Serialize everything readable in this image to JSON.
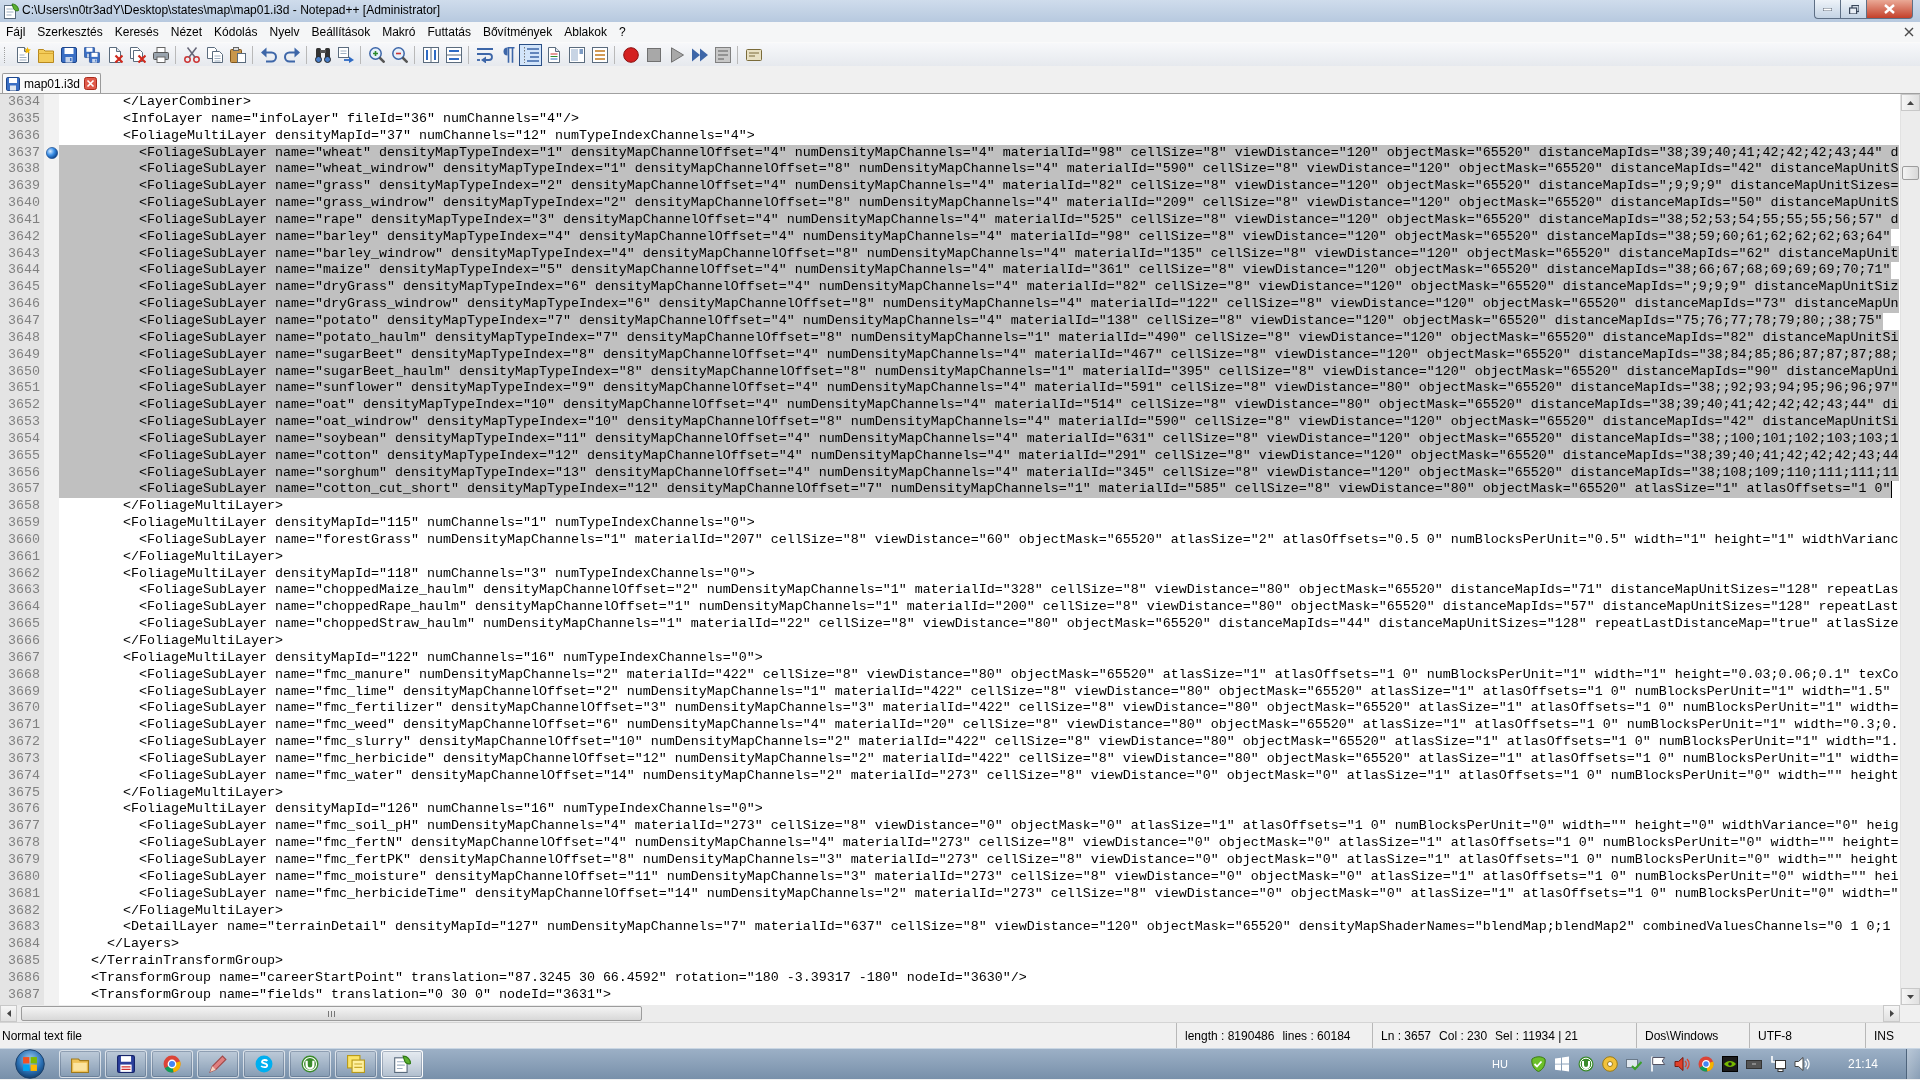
{
  "window": {
    "title": "C:\\Users\\n0tr3adY\\Desktop\\states\\map\\map01.i3d - Notepad++ [Administrator]"
  },
  "menu": [
    "Fájl",
    "Szerkesztés",
    "Keresés",
    "Nézet",
    "Kódolás",
    "Nyelv",
    "Beállítások",
    "Makró",
    "Futtatás",
    "Bővítmények",
    "Ablakok",
    "?"
  ],
  "toolbar": {
    "groups": [
      [
        {
          "pressed": false
        },
        {
          "pressed": false
        },
        {
          "pressed": false
        },
        {
          "pressed": false
        },
        {
          "pressed": false
        },
        {
          "pressed": false
        },
        {
          "pressed": false
        }
      ],
      [
        {
          "pressed": false
        },
        {
          "pressed": false
        },
        {
          "pressed": false
        }
      ],
      [
        {
          "pressed": false
        },
        {
          "pressed": false
        }
      ],
      [
        {
          "pressed": false
        },
        {
          "pressed": false
        }
      ],
      [
        {
          "pressed": false
        },
        {
          "pressed": false
        }
      ],
      [
        {
          "pressed": false
        },
        {
          "pressed": false
        }
      ],
      [
        {
          "pressed": false
        },
        {
          "pressed": false
        },
        {
          "pressed": true
        },
        {
          "pressed": false
        },
        {
          "pressed": false
        },
        {
          "pressed": false
        }
      ],
      [
        {
          "pressed": false
        },
        {
          "pressed": false
        },
        {
          "pressed": false
        },
        {
          "pressed": false
        },
        {
          "pressed": false
        }
      ],
      [
        {
          "pressed": false
        }
      ]
    ]
  },
  "tabs": [
    {
      "label": "map01.i3d",
      "selected": true,
      "modified": false
    }
  ],
  "editor": {
    "lines": [
      {
        "number": "3634",
        "text": "        </LayerCombiner>",
        "selected": false,
        "bookmarked": false,
        "caret": false
      },
      {
        "number": "3635",
        "text": "        <InfoLayer name=\"infoLayer\" fileId=\"36\" numChannels=\"4\"/>",
        "selected": false,
        "bookmarked": false,
        "caret": false
      },
      {
        "number": "3636",
        "text": "        <FoliageMultiLayer densityMapId=\"37\" numChannels=\"12\" numTypeIndexChannels=\"4\">",
        "selected": false,
        "bookmarked": false,
        "caret": false
      },
      {
        "number": "3637",
        "text": "          <FoliageSubLayer name=\"wheat\" densityMapTypeIndex=\"1\" densityMapChannelOffset=\"4\" numDensityMapChannels=\"4\" materialId=\"98\" cellSize=\"8\" viewDistance=\"120\" objectMask=\"65520\" distanceMapIds=\"38;39;40;41;42;42;42;43;44\" d",
        "selected": true,
        "bookmarked": true,
        "caret": false
      },
      {
        "number": "3638",
        "text": "          <FoliageSubLayer name=\"wheat_windrow\" densityMapTypeIndex=\"1\" densityMapChannelOffset=\"8\" numDensityMapChannels=\"4\" materialId=\"590\" cellSize=\"8\" viewDistance=\"120\" objectMask=\"65520\" distanceMapIds=\"42\" distanceMapUnitS",
        "selected": true,
        "bookmarked": false,
        "caret": false
      },
      {
        "number": "3639",
        "text": "          <FoliageSubLayer name=\"grass\" densityMapTypeIndex=\"2\" densityMapChannelOffset=\"4\" numDensityMapChannels=\"4\" materialId=\"82\" cellSize=\"8\" viewDistance=\"120\" objectMask=\"65520\" distanceMapIds=\";9;9;9\" distanceMapUnitSizes=",
        "selected": true,
        "bookmarked": false,
        "caret": false
      },
      {
        "number": "3640",
        "text": "          <FoliageSubLayer name=\"grass_windrow\" densityMapTypeIndex=\"2\" densityMapChannelOffset=\"8\" numDensityMapChannels=\"4\" materialId=\"209\" cellSize=\"8\" viewDistance=\"120\" objectMask=\"65520\" distanceMapIds=\"50\" distanceMapUnitS",
        "selected": true,
        "bookmarked": false,
        "caret": false
      },
      {
        "number": "3641",
        "text": "          <FoliageSubLayer name=\"rape\" densityMapTypeIndex=\"3\" densityMapChannelOffset=\"4\" numDensityMapChannels=\"4\" materialId=\"525\" cellSize=\"8\" viewDistance=\"120\" objectMask=\"65520\" distanceMapIds=\"38;52;53;54;55;55;55;56;57\" d",
        "selected": true,
        "bookmarked": false,
        "caret": false
      },
      {
        "number": "3642",
        "text": "          <FoliageSubLayer name=\"barley\" densityMapTypeIndex=\"4\" densityMapChannelOffset=\"4\" numDensityMapChannels=\"4\" materialId=\"98\" cellSize=\"8\" viewDistance=\"120\" objectMask=\"65520\" distanceMapIds=\"38;59;60;61;62;62;62;63;64\"",
        "selected": true,
        "bookmarked": false,
        "caret": false
      },
      {
        "number": "3643",
        "text": "          <FoliageSubLayer name=\"barley_windrow\" densityMapTypeIndex=\"4\" densityMapChannelOffset=\"8\" numDensityMapChannels=\"4\" materialId=\"135\" cellSize=\"8\" viewDistance=\"120\" objectMask=\"65520\" distanceMapIds=\"62\" distanceMapUnit",
        "selected": true,
        "bookmarked": false,
        "caret": false
      },
      {
        "number": "3644",
        "text": "          <FoliageSubLayer name=\"maize\" densityMapTypeIndex=\"5\" densityMapChannelOffset=\"4\" numDensityMapChannels=\"4\" materialId=\"361\" cellSize=\"8\" viewDistance=\"120\" objectMask=\"65520\" distanceMapIds=\"38;66;67;68;69;69;69;70;71\"",
        "selected": true,
        "bookmarked": false,
        "caret": false
      },
      {
        "number": "3645",
        "text": "          <FoliageSubLayer name=\"dryGrass\" densityMapTypeIndex=\"6\" densityMapChannelOffset=\"4\" numDensityMapChannels=\"4\" materialId=\"82\" cellSize=\"8\" viewDistance=\"120\" objectMask=\"65520\" distanceMapIds=\";9;9;9\" distanceMapUnitSiz",
        "selected": true,
        "bookmarked": false,
        "caret": false
      },
      {
        "number": "3646",
        "text": "          <FoliageSubLayer name=\"dryGrass_windrow\" densityMapTypeIndex=\"6\" densityMapChannelOffset=\"8\" numDensityMapChannels=\"4\" materialId=\"122\" cellSize=\"8\" viewDistance=\"120\" objectMask=\"65520\" distanceMapIds=\"73\" distanceMapUn",
        "selected": true,
        "bookmarked": false,
        "caret": false
      },
      {
        "number": "3647",
        "text": "          <FoliageSubLayer name=\"potato\" densityMapTypeIndex=\"7\" densityMapChannelOffset=\"4\" numDensityMapChannels=\"4\" materialId=\"138\" cellSize=\"8\" viewDistance=\"120\" objectMask=\"65520\" distanceMapIds=\"75;76;77;78;79;80;;38;75\"",
        "selected": true,
        "bookmarked": false,
        "caret": false
      },
      {
        "number": "3648",
        "text": "          <FoliageSubLayer name=\"potato_haulm\" densityMapTypeIndex=\"7\" densityMapChannelOffset=\"8\" numDensityMapChannels=\"1\" materialId=\"490\" cellSize=\"8\" viewDistance=\"120\" objectMask=\"65520\" distanceMapIds=\"82\" distanceMapUnitSi",
        "selected": true,
        "bookmarked": false,
        "caret": false
      },
      {
        "number": "3649",
        "text": "          <FoliageSubLayer name=\"sugarBeet\" densityMapTypeIndex=\"8\" densityMapChannelOffset=\"4\" numDensityMapChannels=\"4\" materialId=\"467\" cellSize=\"8\" viewDistance=\"120\" objectMask=\"65520\" distanceMapIds=\"38;84;85;86;87;87;87;88;",
        "selected": true,
        "bookmarked": false,
        "caret": false
      },
      {
        "number": "3650",
        "text": "          <FoliageSubLayer name=\"sugarBeet_haulm\" densityMapTypeIndex=\"8\" densityMapChannelOffset=\"8\" numDensityMapChannels=\"1\" materialId=\"395\" cellSize=\"8\" viewDistance=\"120\" objectMask=\"65520\" distanceMapIds=\"90\" distanceMapUni",
        "selected": true,
        "bookmarked": false,
        "caret": false
      },
      {
        "number": "3651",
        "text": "          <FoliageSubLayer name=\"sunflower\" densityMapTypeIndex=\"9\" densityMapChannelOffset=\"4\" numDensityMapChannels=\"4\" materialId=\"591\" cellSize=\"8\" viewDistance=\"80\" objectMask=\"65520\" distanceMapIds=\"38;;92;93;94;95;96;96;97\"",
        "selected": true,
        "bookmarked": false,
        "caret": false
      },
      {
        "number": "3652",
        "text": "          <FoliageSubLayer name=\"oat\" densityMapTypeIndex=\"10\" densityMapChannelOffset=\"4\" numDensityMapChannels=\"4\" materialId=\"514\" cellSize=\"8\" viewDistance=\"80\" objectMask=\"65520\" distanceMapIds=\"38;39;40;41;42;42;42;43;44\" di",
        "selected": true,
        "bookmarked": false,
        "caret": false
      },
      {
        "number": "3653",
        "text": "          <FoliageSubLayer name=\"oat_windrow\" densityMapTypeIndex=\"10\" densityMapChannelOffset=\"8\" numDensityMapChannels=\"4\" materialId=\"590\" cellSize=\"8\" viewDistance=\"120\" objectMask=\"65520\" distanceMapIds=\"42\" distanceMapUnitSi",
        "selected": true,
        "bookmarked": false,
        "caret": false
      },
      {
        "number": "3654",
        "text": "          <FoliageSubLayer name=\"soybean\" densityMapTypeIndex=\"11\" densityMapChannelOffset=\"4\" numDensityMapChannels=\"4\" materialId=\"631\" cellSize=\"8\" viewDistance=\"120\" objectMask=\"65520\" distanceMapIds=\"38;;100;101;102;103;103;1",
        "selected": true,
        "bookmarked": false,
        "caret": false
      },
      {
        "number": "3655",
        "text": "          <FoliageSubLayer name=\"cotton\" densityMapTypeIndex=\"12\" densityMapChannelOffset=\"4\" numDensityMapChannels=\"4\" materialId=\"291\" cellSize=\"8\" viewDistance=\"120\" objectMask=\"65520\" distanceMapIds=\"38;39;40;41;42;42;42;43;44",
        "selected": true,
        "bookmarked": false,
        "caret": false
      },
      {
        "number": "3656",
        "text": "          <FoliageSubLayer name=\"sorghum\" densityMapTypeIndex=\"13\" densityMapChannelOffset=\"4\" numDensityMapChannels=\"4\" materialId=\"345\" cellSize=\"8\" viewDistance=\"120\" objectMask=\"65520\" distanceMapIds=\"38;108;109;110;111;111;11",
        "selected": true,
        "bookmarked": false,
        "caret": false
      },
      {
        "number": "3657",
        "text": "          <FoliageSubLayer name=\"cotton_cut_short\" densityMapTypeIndex=\"12\" densityMapChannelOffset=\"7\" numDensityMapChannels=\"1\" materialId=\"585\" cellSize=\"8\" viewDistance=\"80\" objectMask=\"65520\" atlasSize=\"1\" atlasOffsets=\"1 0\"",
        "selected": true,
        "bookmarked": false,
        "caret": true
      },
      {
        "number": "3658",
        "text": "        </FoliageMultiLayer>",
        "selected": false,
        "bookmarked": false,
        "caret": false
      },
      {
        "number": "3659",
        "text": "        <FoliageMultiLayer densityMapId=\"115\" numChannels=\"1\" numTypeIndexChannels=\"0\">",
        "selected": false,
        "bookmarked": false,
        "caret": false
      },
      {
        "number": "3660",
        "text": "          <FoliageSubLayer name=\"forestGrass\" numDensityMapChannels=\"1\" materialId=\"207\" cellSize=\"8\" viewDistance=\"60\" objectMask=\"65520\" atlasSize=\"2\" atlasOffsets=\"0.5 0\" numBlocksPerUnit=\"0.5\" width=\"1\" height=\"1\" widthVarianc",
        "selected": false,
        "bookmarked": false,
        "caret": false
      },
      {
        "number": "3661",
        "text": "        </FoliageMultiLayer>",
        "selected": false,
        "bookmarked": false,
        "caret": false
      },
      {
        "number": "3662",
        "text": "        <FoliageMultiLayer densityMapId=\"118\" numChannels=\"3\" numTypeIndexChannels=\"0\">",
        "selected": false,
        "bookmarked": false,
        "caret": false
      },
      {
        "number": "3663",
        "text": "          <FoliageSubLayer name=\"choppedMaize_haulm\" densityMapChannelOffset=\"2\" numDensityMapChannels=\"1\" materialId=\"328\" cellSize=\"8\" viewDistance=\"80\" objectMask=\"65520\" distanceMapIds=\"71\" distanceMapUnitSizes=\"128\" repeatLas",
        "selected": false,
        "bookmarked": false,
        "caret": false
      },
      {
        "number": "3664",
        "text": "          <FoliageSubLayer name=\"choppedRape_haulm\" densityMapChannelOffset=\"1\" numDensityMapChannels=\"1\" materialId=\"200\" cellSize=\"8\" viewDistance=\"80\" objectMask=\"65520\" distanceMapIds=\"57\" distanceMapUnitSizes=\"128\" repeatLast",
        "selected": false,
        "bookmarked": false,
        "caret": false
      },
      {
        "number": "3665",
        "text": "          <FoliageSubLayer name=\"choppedStraw_haulm\" numDensityMapChannels=\"1\" materialId=\"22\" cellSize=\"8\" viewDistance=\"80\" objectMask=\"65520\" distanceMapIds=\"44\" distanceMapUnitSizes=\"128\" repeatLastDistanceMap=\"true\" atlasSize",
        "selected": false,
        "bookmarked": false,
        "caret": false
      },
      {
        "number": "3666",
        "text": "        </FoliageMultiLayer>",
        "selected": false,
        "bookmarked": false,
        "caret": false
      },
      {
        "number": "3667",
        "text": "        <FoliageMultiLayer densityMapId=\"122\" numChannels=\"16\" numTypeIndexChannels=\"0\">",
        "selected": false,
        "bookmarked": false,
        "caret": false
      },
      {
        "number": "3668",
        "text": "          <FoliageSubLayer name=\"fmc_manure\" numDensityMapChannels=\"2\" materialId=\"422\" cellSize=\"8\" viewDistance=\"80\" objectMask=\"65520\" atlasSize=\"1\" atlasOffsets=\"1 0\" numBlocksPerUnit=\"1\" width=\"1\" height=\"0.03;0.06;0.1\" texCo",
        "selected": false,
        "bookmarked": false,
        "caret": false
      },
      {
        "number": "3669",
        "text": "          <FoliageSubLayer name=\"fmc_lime\" densityMapChannelOffset=\"2\" numDensityMapChannels=\"1\" materialId=\"422\" cellSize=\"8\" viewDistance=\"80\" objectMask=\"65520\" atlasSize=\"1\" atlasOffsets=\"1 0\" numBlocksPerUnit=\"1\" width=\"1.5\"",
        "selected": false,
        "bookmarked": false,
        "caret": false
      },
      {
        "number": "3670",
        "text": "          <FoliageSubLayer name=\"fmc_fertilizer\" densityMapChannelOffset=\"3\" numDensityMapChannels=\"3\" materialId=\"422\" cellSize=\"8\" viewDistance=\"80\" objectMask=\"65520\" atlasSize=\"1\" atlasOffsets=\"1 0\" numBlocksPerUnit=\"1\" width=",
        "selected": false,
        "bookmarked": false,
        "caret": false
      },
      {
        "number": "3671",
        "text": "          <FoliageSubLayer name=\"fmc_weed\" densityMapChannelOffset=\"6\" numDensityMapChannels=\"4\" materialId=\"20\" cellSize=\"8\" viewDistance=\"80\" objectMask=\"65520\" atlasSize=\"1\" atlasOffsets=\"1 0\" numBlocksPerUnit=\"1\" width=\"0.3;0.",
        "selected": false,
        "bookmarked": false,
        "caret": false
      },
      {
        "number": "3672",
        "text": "          <FoliageSubLayer name=\"fmc_slurry\" densityMapChannelOffset=\"10\" numDensityMapChannels=\"2\" materialId=\"422\" cellSize=\"8\" viewDistance=\"80\" objectMask=\"65520\" atlasSize=\"1\" atlasOffsets=\"1 0\" numBlocksPerUnit=\"1\" width=\"1.",
        "selected": false,
        "bookmarked": false,
        "caret": false
      },
      {
        "number": "3673",
        "text": "          <FoliageSubLayer name=\"fmc_herbicide\" densityMapChannelOffset=\"12\" numDensityMapChannels=\"2\" materialId=\"422\" cellSize=\"8\" viewDistance=\"80\" objectMask=\"65520\" atlasSize=\"1\" atlasOffsets=\"1 0\" numBlocksPerUnit=\"1\" width=",
        "selected": false,
        "bookmarked": false,
        "caret": false
      },
      {
        "number": "3674",
        "text": "          <FoliageSubLayer name=\"fmc_water\" densityMapChannelOffset=\"14\" numDensityMapChannels=\"2\" materialId=\"273\" cellSize=\"8\" viewDistance=\"0\" objectMask=\"0\" atlasSize=\"1\" atlasOffsets=\"1 0\" numBlocksPerUnit=\"0\" width=\"\" height",
        "selected": false,
        "bookmarked": false,
        "caret": false
      },
      {
        "number": "3675",
        "text": "        </FoliageMultiLayer>",
        "selected": false,
        "bookmarked": false,
        "caret": false
      },
      {
        "number": "3676",
        "text": "        <FoliageMultiLayer densityMapId=\"126\" numChannels=\"16\" numTypeIndexChannels=\"0\">",
        "selected": false,
        "bookmarked": false,
        "caret": false
      },
      {
        "number": "3677",
        "text": "          <FoliageSubLayer name=\"fmc_soil_pH\" numDensityMapChannels=\"4\" materialId=\"273\" cellSize=\"8\" viewDistance=\"0\" objectMask=\"0\" atlasSize=\"1\" atlasOffsets=\"1 0\" numBlocksPerUnit=\"0\" width=\"\" height=\"0\" widthVariance=\"0\" heig",
        "selected": false,
        "bookmarked": false,
        "caret": false
      },
      {
        "number": "3678",
        "text": "          <FoliageSubLayer name=\"fmc_fertN\" densityMapChannelOffset=\"4\" numDensityMapChannels=\"4\" materialId=\"273\" cellSize=\"8\" viewDistance=\"0\" objectMask=\"0\" atlasSize=\"1\" atlasOffsets=\"1 0\" numBlocksPerUnit=\"0\" width=\"\" height=",
        "selected": false,
        "bookmarked": false,
        "caret": false
      },
      {
        "number": "3679",
        "text": "          <FoliageSubLayer name=\"fmc_fertPK\" densityMapChannelOffset=\"8\" numDensityMapChannels=\"3\" materialId=\"273\" cellSize=\"8\" viewDistance=\"0\" objectMask=\"0\" atlasSize=\"1\" atlasOffsets=\"1 0\" numBlocksPerUnit=\"0\" width=\"\" height",
        "selected": false,
        "bookmarked": false,
        "caret": false
      },
      {
        "number": "3680",
        "text": "          <FoliageSubLayer name=\"fmc_moisture\" densityMapChannelOffset=\"11\" numDensityMapChannels=\"3\" materialId=\"273\" cellSize=\"8\" viewDistance=\"0\" objectMask=\"0\" atlasSize=\"1\" atlasOffsets=\"1 0\" numBlocksPerUnit=\"0\" width=\"\" hei",
        "selected": false,
        "bookmarked": false,
        "caret": false
      },
      {
        "number": "3681",
        "text": "          <FoliageSubLayer name=\"fmc_herbicideTime\" densityMapChannelOffset=\"14\" numDensityMapChannels=\"2\" materialId=\"273\" cellSize=\"8\" viewDistance=\"0\" objectMask=\"0\" atlasSize=\"1\" atlasOffsets=\"1 0\" numBlocksPerUnit=\"0\" width=\"",
        "selected": false,
        "bookmarked": false,
        "caret": false
      },
      {
        "number": "3682",
        "text": "        </FoliageMultiLayer>",
        "selected": false,
        "bookmarked": false,
        "caret": false
      },
      {
        "number": "3683",
        "text": "        <DetailLayer name=\"terrainDetail\" densityMapId=\"127\" numDensityMapChannels=\"7\" materialId=\"637\" cellSize=\"8\" viewDistance=\"120\" objectMask=\"65520\" densityMapShaderNames=\"blendMap;blendMap2\" combinedValuesChannels=\"0 1 0;1",
        "selected": false,
        "bookmarked": false,
        "caret": false
      },
      {
        "number": "3684",
        "text": "      </Layers>",
        "selected": false,
        "bookmarked": false,
        "caret": false
      },
      {
        "number": "3685",
        "text": "    </TerrainTransformGroup>",
        "selected": false,
        "bookmarked": false,
        "caret": false
      },
      {
        "number": "3686",
        "text": "    <TransformGroup name=\"careerStartPoint\" translation=\"87.3245 30 66.4592\" rotation=\"180 -3.39317 -180\" nodeId=\"3630\"/>",
        "selected": false,
        "bookmarked": false,
        "caret": false
      },
      {
        "number": "3687",
        "text": "    <TransformGroup name=\"fields\" translation=\"0 30 0\" nodeId=\"3631\">",
        "selected": false,
        "bookmarked": false,
        "caret": false
      }
    ]
  },
  "status_bar": {
    "file_type": "Normal text file",
    "length": "length : 8190486",
    "line_count": "lines : 60184",
    "line": "Ln : 3657",
    "column": "Col : 230",
    "selection": "Sel : 11934 | 21",
    "eol": "Dos\\Windows",
    "encoding": "UTF-8",
    "insert_mode": "INS"
  },
  "taskbar": {
    "apps": [
      {
        "active": false
      },
      {
        "active": false
      },
      {
        "active": false
      },
      {
        "active": false
      },
      {
        "active": false
      },
      {
        "active": false
      },
      {
        "active": false
      },
      {
        "active": true
      }
    ],
    "language": "HU",
    "clock": "21:14"
  }
}
